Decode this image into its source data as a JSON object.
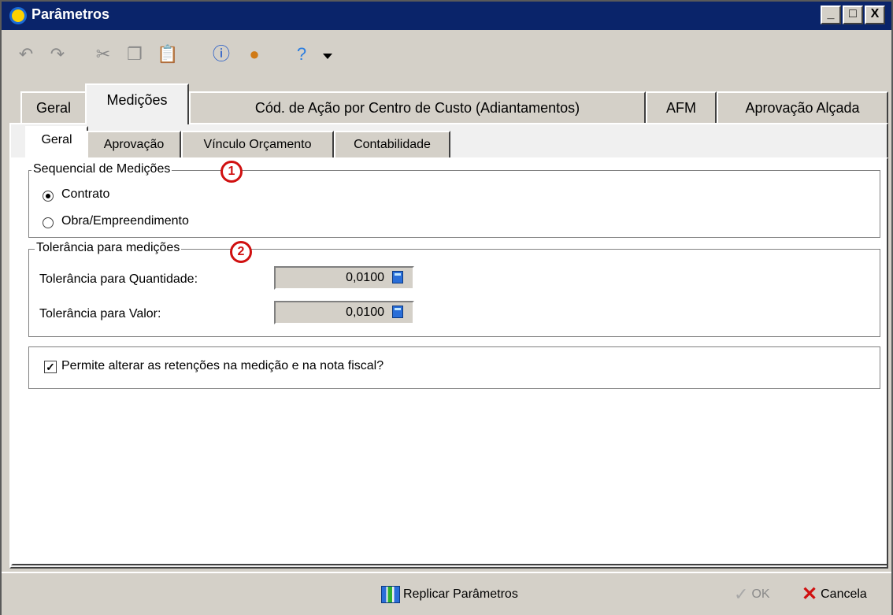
{
  "window": {
    "title": "Parâmetros",
    "minimize_symbol": "_",
    "maximize_symbol": "□",
    "close_symbol": "X"
  },
  "toolbar": {
    "icons": [
      "undo-icon",
      "redo-icon",
      "cut-icon",
      "copy-icon",
      "paste-icon",
      "info-icon",
      "user-icon",
      "help-icon",
      "dropdown-arrow-icon"
    ]
  },
  "main_tabs": [
    {
      "label": "Geral",
      "active": false
    },
    {
      "label": "Medições",
      "active": true
    },
    {
      "label": "Cód. de Ação por Centro de Custo (Adiantamentos)",
      "active": false
    },
    {
      "label": "AFM",
      "active": false
    },
    {
      "label": "Aprovação Alçada",
      "active": false
    }
  ],
  "sub_tabs": [
    {
      "label": "Geral",
      "active": true
    },
    {
      "label": "Aprovação",
      "active": false
    },
    {
      "label": "Vínculo Orçamento",
      "active": false
    },
    {
      "label": "Contabilidade",
      "active": false
    }
  ],
  "sequencial": {
    "legend": "Sequencial de Medições",
    "badge": "1",
    "options": [
      {
        "label": "Contrato",
        "checked": true
      },
      {
        "label": "Obra/Empreendimento",
        "checked": false
      }
    ]
  },
  "tolerancia": {
    "legend": "Tolerância para medições",
    "badge": "2",
    "quantidade": {
      "label": "Tolerância para Quantidade:",
      "value": "0,0100"
    },
    "valor": {
      "label": "Tolerância para Valor:",
      "value": "0,0100"
    }
  },
  "retencoes": {
    "label": "Permite alterar as retenções na medição e na nota fiscal?",
    "checked": true,
    "check_symbol": "✓"
  },
  "bottom": {
    "replicar_label": "Replicar Parâmetros",
    "ok_label": "OK",
    "cancel_label": "Cancela",
    "ok_symbol": "✓",
    "cancel_symbol": "✕"
  },
  "colors": {
    "titlebar": "#0a246a",
    "badge": "#d01010",
    "window_bg": "#d4d0c8"
  }
}
